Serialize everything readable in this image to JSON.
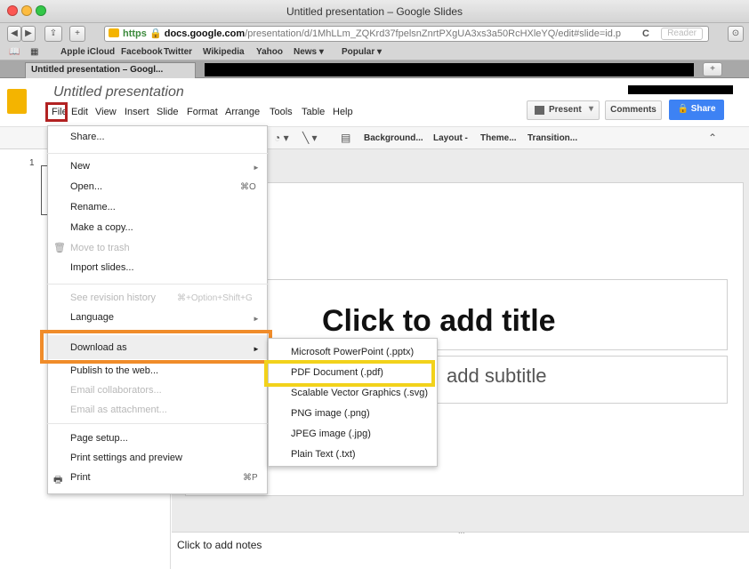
{
  "window": {
    "title": "Untitled presentation – Google Slides",
    "traffic_colors": [
      "#fc5753",
      "#fdbc40",
      "#33c748"
    ]
  },
  "browser": {
    "url_prefix": "https",
    "url_host": "docs.google.com",
    "url_path": "/presentation/d/1MhLLm_ZQKrd37fpelsnZnrtPXgUA3xs3a50RcHXleYQ/edit#slide=id.p",
    "reader_label": "Reader",
    "reload_glyph": "C",
    "bookmarks": [
      "Apple",
      "iCloud",
      "Facebook",
      "Twitter",
      "Wikipedia",
      "Yahoo",
      "News ▾",
      "Popular ▾"
    ],
    "tab_label": "Untitled presentation – Googl...",
    "new_tab_glyph": "+"
  },
  "slides_app": {
    "doc_title": "Untitled presentation",
    "menu": [
      "File",
      "Edit",
      "View",
      "Insert",
      "Slide",
      "Format",
      "Arrange",
      "Tools",
      "Table",
      "Help"
    ],
    "present_label": "Present",
    "comments_label": "Comments",
    "share_label": "Share",
    "brand_color": "#f4b400",
    "share_color": "#3d82f4",
    "format_bar": {
      "background_label": "Background...",
      "layout_label": "Layout -",
      "theme_label": "Theme...",
      "transition_label": "Transition...",
      "collapse_glyph": "≈"
    },
    "slide_number": "1",
    "title_placeholder": "Click to add title",
    "subtitle_placeholder": "add subtitle",
    "notes_placeholder": "Click to add notes",
    "notes_handle": "..."
  },
  "file_menu": {
    "items": [
      {
        "label": "Share...",
        "shortcut": "",
        "submenu": false,
        "disabled": false
      },
      {
        "label": "New",
        "shortcut": "",
        "submenu": true,
        "disabled": false
      },
      {
        "label": "Open...",
        "shortcut": "⌘O",
        "submenu": false,
        "disabled": false
      },
      {
        "label": "Rename...",
        "shortcut": "",
        "submenu": false,
        "disabled": false
      },
      {
        "label": "Make a copy...",
        "shortcut": "",
        "submenu": false,
        "disabled": false
      },
      {
        "label": "Move to trash",
        "shortcut": "",
        "submenu": false,
        "disabled": true
      },
      {
        "label": "Import slides...",
        "shortcut": "",
        "submenu": false,
        "disabled": false
      },
      {
        "label": "See revision history",
        "shortcut": "⌘+Option+Shift+G",
        "submenu": false,
        "disabled": true
      },
      {
        "label": "Language",
        "shortcut": "",
        "submenu": true,
        "disabled": false
      },
      {
        "label": "Download as",
        "shortcut": "",
        "submenu": true,
        "disabled": false
      },
      {
        "label": "Publish to the web...",
        "shortcut": "",
        "submenu": false,
        "disabled": false
      },
      {
        "label": "Email collaborators...",
        "shortcut": "",
        "submenu": false,
        "disabled": true
      },
      {
        "label": "Email as attachment...",
        "shortcut": "",
        "submenu": false,
        "disabled": true
      },
      {
        "label": "Page setup...",
        "shortcut": "",
        "submenu": false,
        "disabled": false
      },
      {
        "label": "Print settings and preview",
        "shortcut": "",
        "submenu": false,
        "disabled": false
      },
      {
        "label": "Print",
        "shortcut": "⌘P",
        "submenu": false,
        "disabled": false
      }
    ]
  },
  "download_submenu": {
    "items": [
      "Microsoft PowerPoint (.pptx)",
      "PDF Document (.pdf)",
      "Scalable Vector Graphics (.svg)",
      "PNG image (.png)",
      "JPEG image (.jpg)",
      "Plain Text (.txt)"
    ]
  },
  "annotations": {
    "file_highlight_color": "#b22222",
    "download_highlight_color": "#f08c2a",
    "pdf_highlight_color": "#f2d21b"
  }
}
